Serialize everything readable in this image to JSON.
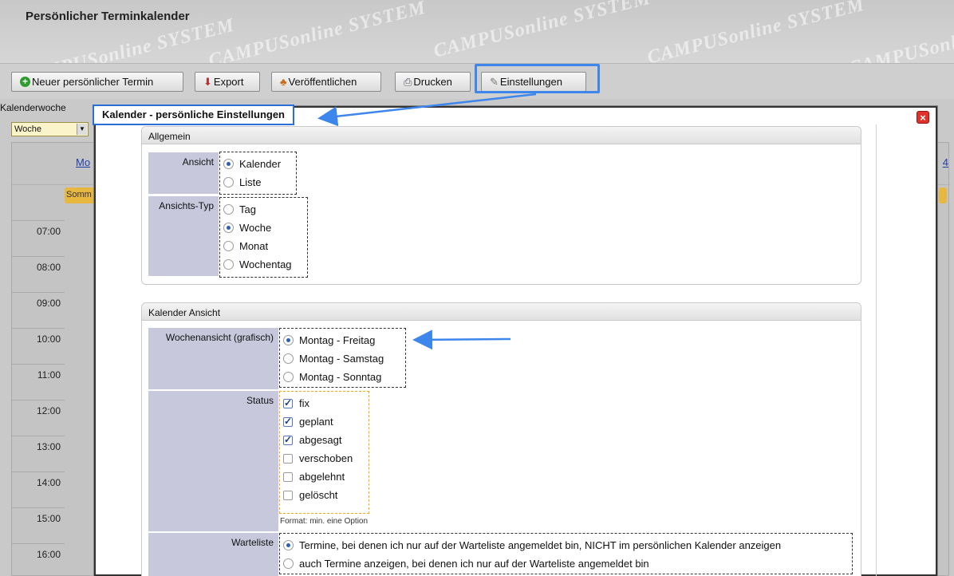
{
  "app": {
    "title": "Persönlicher Terminkalender",
    "watermark": "CAMPUSonline SYSTEM"
  },
  "toolbar": {
    "new_label": "Neuer persönlicher Termin",
    "export_label": "Export",
    "publish_label": "Veröffentlichen",
    "print_label": "Drucken",
    "settings_label": "Einstellungen"
  },
  "calendar": {
    "week_label": "Kalenderwoche",
    "view_value": "Woche",
    "day_header": "Mo",
    "right_header": "4",
    "event_label": "Somm",
    "times": [
      "07:00",
      "08:00",
      "09:00",
      "10:00",
      "11:00",
      "12:00",
      "13:00",
      "14:00",
      "15:00",
      "16:00"
    ]
  },
  "dialog": {
    "title": "Kalender - persönliche Einstellungen",
    "close_icon": "close-icon",
    "general": {
      "heading": "Allgemein",
      "ansicht_label": "Ansicht",
      "ansicht_options": [
        "Kalender",
        "Liste"
      ],
      "ansicht_selected": "Kalender",
      "typ_label": "Ansichts-Typ",
      "typ_options": [
        "Tag",
        "Woche",
        "Monat",
        "Wochentag"
      ],
      "typ_selected": "Woche"
    },
    "calendar_view": {
      "heading": "Kalender Ansicht",
      "week_label": "Wochenansicht (grafisch)",
      "week_options": [
        "Montag - Freitag",
        "Montag - Samstag",
        "Montag - Sonntag"
      ],
      "week_selected": "Montag - Freitag",
      "status_label": "Status",
      "status_options": [
        "fix",
        "geplant",
        "abgesagt",
        "verschoben",
        "abgelehnt",
        "gelöscht"
      ],
      "status_checked": [
        "fix",
        "geplant",
        "abgesagt"
      ],
      "status_hint": "Format: min. eine Option",
      "wait_label": "Warteliste",
      "wait_options": [
        "Termine, bei denen ich nur auf der Warteliste angemeldet bin, NICHT im persönlichen Kalender anzeigen",
        "auch Termine anzeigen, bei denen ich nur auf der Warteliste angemeldet bin"
      ],
      "wait_selected": "Termine, bei denen ich nur auf der Warteliste angemeldet bin, NICHT im persönlichen Kalender anzeigen"
    }
  },
  "colors": {
    "annotation_blue": "#3d86ec",
    "label_bg": "#c7c8dc",
    "status_border": "#f2a91c",
    "close_red": "#e0312a"
  }
}
